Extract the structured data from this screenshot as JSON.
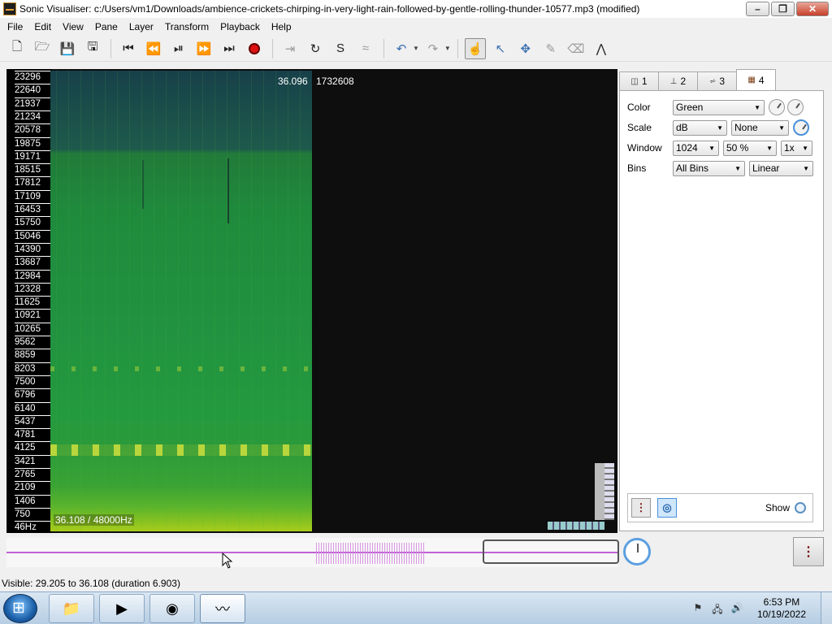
{
  "window": {
    "title": "Sonic Visualiser: c:/Users/vm1/Downloads/ambience-crickets-chirping-in-very-light-rain-followed-by-gentle-rolling-thunder-10577.mp3 (modified)",
    "minimize": "–",
    "maximize": "❐",
    "close": "✕"
  },
  "menu": [
    "File",
    "Edit",
    "View",
    "Pane",
    "Layer",
    "Transform",
    "Playback",
    "Help"
  ],
  "toolbar": {
    "icons": [
      "new-icon",
      "open-icon",
      "save-icon",
      "save-as-icon",
      "rewind-start-icon",
      "rewind-icon",
      "play-pause-icon",
      "fast-forward-icon",
      "forward-end-icon",
      "record-icon",
      "play-selection-icon",
      "loop-icon",
      "solo-icon",
      "follow-icon",
      "undo-icon",
      "redo-icon",
      "navigate-icon",
      "select-icon",
      "move-icon",
      "draw-icon",
      "erase-icon",
      "measure-icon"
    ]
  },
  "frequency_labels": [
    "23296",
    "22640",
    "21937",
    "21234",
    "20578",
    "19875",
    "19171",
    "18515",
    "17812",
    "17109",
    "16453",
    "15750",
    "15046",
    "14390",
    "13687",
    "12984",
    "12328",
    "11625",
    "10921",
    "10265",
    "9562",
    "8859",
    "8203",
    "7500",
    "6796",
    "6140",
    "5437",
    "4781",
    "4125",
    "3421",
    "2765",
    "2109",
    "1406",
    "750",
    "46Hz"
  ],
  "pane": {
    "time_label": "36.096",
    "frame_label": "1732608",
    "bottom_label": "36.108 / 48000Hz"
  },
  "properties": {
    "tabs": [
      {
        "icon": "pane-icon",
        "label": "1"
      },
      {
        "icon": "ruler-icon",
        "label": "2"
      },
      {
        "icon": "waveform-icon",
        "label": "3"
      },
      {
        "icon": "spectrogram-icon",
        "label": "4"
      }
    ],
    "color_label": "Color",
    "color_value": "Green",
    "scale_label": "Scale",
    "scale_value": "dB",
    "scale_normalize": "None",
    "window_label": "Window",
    "window_size": "1024",
    "window_overlap": "50 %",
    "window_oversample": "1x",
    "bins_label": "Bins",
    "bins_value": "All Bins",
    "bins_scale": "Linear",
    "show_label": "Show"
  },
  "status": {
    "visible": "Visible: 29.205 to 36.108 (duration 6.903)"
  },
  "taskbar": {
    "time": "6:53 PM",
    "date": "10/19/2022"
  }
}
